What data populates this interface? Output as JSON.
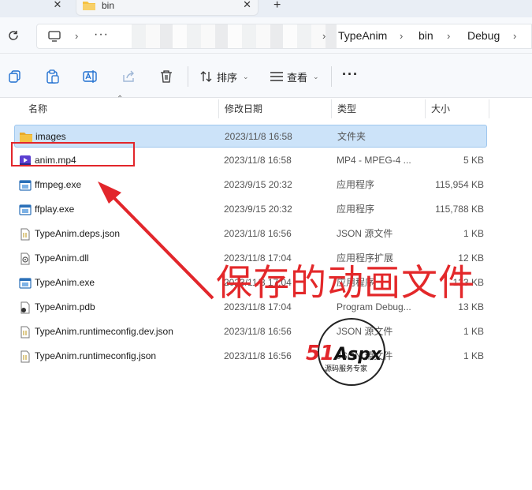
{
  "tabs": {
    "active_title": "bin"
  },
  "address": {
    "crumbs": [
      "TypeAnim",
      "bin",
      "Debug"
    ]
  },
  "toolbar": {
    "sort_label": "排序",
    "view_label": "查看"
  },
  "columns": {
    "name": "名称",
    "date": "修改日期",
    "type": "类型",
    "size": "大小"
  },
  "files": [
    {
      "name": "images",
      "date": "2023/11/8 16:58",
      "type": "文件夹",
      "size": "",
      "icon": "folder-icon",
      "selected": true
    },
    {
      "name": "anim.mp4",
      "date": "2023/11/8 16:58",
      "type": "MP4 - MPEG-4 ...",
      "size": "5 KB",
      "icon": "mp4-icon"
    },
    {
      "name": "ffmpeg.exe",
      "date": "2023/9/15 20:32",
      "type": "应用程序",
      "size": "115,954 KB",
      "icon": "exe-icon"
    },
    {
      "name": "ffplay.exe",
      "date": "2023/9/15 20:32",
      "type": "应用程序",
      "size": "115,788 KB",
      "icon": "exe-icon"
    },
    {
      "name": "TypeAnim.deps.json",
      "date": "2023/11/8 16:56",
      "type": "JSON 源文件",
      "size": "1 KB",
      "icon": "json-icon"
    },
    {
      "name": "TypeAnim.dll",
      "date": "2023/11/8 17:04",
      "type": "应用程序扩展",
      "size": "12 KB",
      "icon": "dll-icon"
    },
    {
      "name": "TypeAnim.exe",
      "date": "2023/11/8 17:04",
      "type": "应用程序",
      "size": "123 KB",
      "icon": "exe-icon"
    },
    {
      "name": "TypeAnim.pdb",
      "date": "2023/11/8 17:04",
      "type": "Program Debug...",
      "size": "13 KB",
      "icon": "pdb-icon"
    },
    {
      "name": "TypeAnim.runtimeconfig.dev.json",
      "date": "2023/11/8 16:56",
      "type": "JSON 源文件",
      "size": "1 KB",
      "icon": "json-icon"
    },
    {
      "name": "TypeAnim.runtimeconfig.json",
      "date": "2023/11/8 16:56",
      "type": "JSON 源文件",
      "size": "1 KB",
      "icon": "json-icon"
    }
  ],
  "annotation": {
    "text": "保存的动画文件"
  },
  "watermark": {
    "brand": "51Aspx",
    "tagline": "源码服务专家"
  },
  "colors": {
    "selection": "#cce3f9",
    "annotation_red": "#e2262b",
    "folder_yellow": "#f5c242"
  }
}
